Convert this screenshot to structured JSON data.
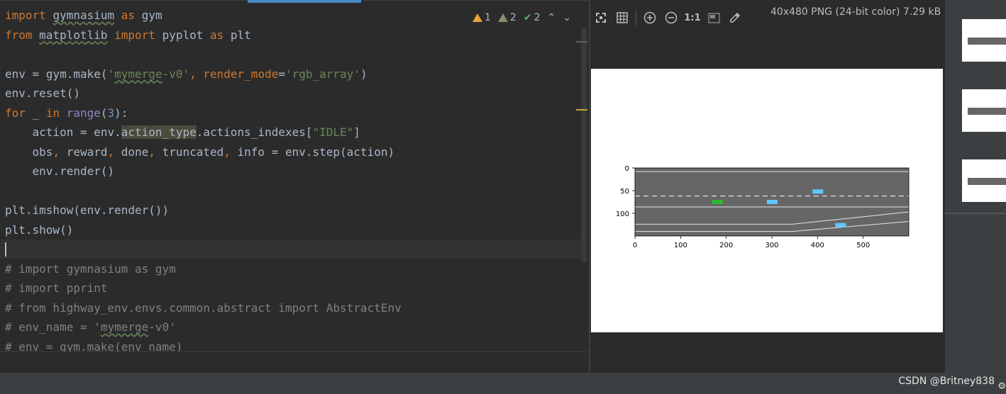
{
  "editor": {
    "lines": [
      [
        {
          "t": "import",
          "c": "kw"
        },
        {
          "t": " "
        },
        {
          "t": "gymnasium",
          "c": "wavy"
        },
        {
          "t": " "
        },
        {
          "t": "as",
          "c": "kw"
        },
        {
          "t": " gym"
        }
      ],
      [
        {
          "t": "from",
          "c": "kw"
        },
        {
          "t": " "
        },
        {
          "t": "matplotlib",
          "c": "wavy"
        },
        {
          "t": " "
        },
        {
          "t": "import",
          "c": "kw"
        },
        {
          "t": " pyplot "
        },
        {
          "t": "as",
          "c": "kw"
        },
        {
          "t": " plt"
        }
      ],
      [
        {
          "t": ""
        }
      ],
      [
        {
          "t": "env = gym.make("
        },
        {
          "t": "'",
          "c": "str"
        },
        {
          "t": "mymerge",
          "c": "str wavy"
        },
        {
          "t": "-v0'",
          "c": "str"
        },
        {
          "t": ", ",
          "c": "kw"
        },
        {
          "t": "render_mode",
          "c": "kw"
        },
        {
          "t": "="
        },
        {
          "t": "'rgb_array'",
          "c": "str"
        },
        {
          "t": ")"
        }
      ],
      [
        {
          "t": "env.reset()"
        }
      ],
      [
        {
          "t": "for",
          "c": "kw"
        },
        {
          "t": " _ "
        },
        {
          "t": "in",
          "c": "kw"
        },
        {
          "t": " "
        },
        {
          "t": "range",
          "c": "builtin"
        },
        {
          "t": "("
        },
        {
          "t": "3",
          "c": "num"
        },
        {
          "t": "):"
        }
      ],
      [
        {
          "t": "    action = env."
        },
        {
          "t": "action_type",
          "c": "hl"
        },
        {
          "t": ".actions_indexes["
        },
        {
          "t": "\"IDLE\"",
          "c": "str"
        },
        {
          "t": "]"
        }
      ],
      [
        {
          "t": "    obs"
        },
        {
          "t": ", ",
          "c": "kw"
        },
        {
          "t": "reward"
        },
        {
          "t": ", ",
          "c": "kw"
        },
        {
          "t": "done"
        },
        {
          "t": ", ",
          "c": "kw"
        },
        {
          "t": "truncated"
        },
        {
          "t": ", ",
          "c": "kw"
        },
        {
          "t": "info = env.step(action)"
        }
      ],
      [
        {
          "t": "    env.render()"
        }
      ],
      [
        {
          "t": ""
        }
      ],
      [
        {
          "t": "plt.imshow(env.render())"
        }
      ],
      [
        {
          "t": "plt.show()"
        }
      ],
      [
        {
          "t": ""
        }
      ],
      [
        {
          "t": "# import gymnasium as gym",
          "c": "comment"
        }
      ],
      [
        {
          "t": "# import pprint",
          "c": "comment"
        }
      ],
      [
        {
          "t": "# from highway_env.envs.common.abstract import AbstractEnv",
          "c": "comment"
        }
      ],
      [
        {
          "t": "# env_name = '",
          "c": "comment"
        },
        {
          "t": "mymerge",
          "c": "comment wavy"
        },
        {
          "t": "-v0'",
          "c": "comment"
        }
      ],
      [
        {
          "t": "# env = gym.make(env_name)",
          "c": "comment"
        }
      ]
    ]
  },
  "inspections": {
    "warnings": "1",
    "weak_warnings": "2",
    "typos": "2"
  },
  "viewer": {
    "image_info": "40x480 PNG (24-bit color) 7.29 kB",
    "actual_size_label": "1:1"
  },
  "plot": {
    "y_ticks": [
      "0",
      "50",
      "100"
    ],
    "x_ticks": [
      "0",
      "100",
      "200",
      "300",
      "400",
      "500"
    ],
    "road_color": "#666666",
    "ego_color": "#2eb82e",
    "vehicle_color": "#5ec8ff"
  },
  "chart_data": {
    "type": "image",
    "xlim": [
      0,
      600
    ],
    "ylim": [
      150,
      0
    ],
    "x_ticks": [
      0,
      100,
      200,
      300,
      400,
      500
    ],
    "y_ticks": [
      0,
      50,
      100
    ],
    "vehicles": [
      {
        "kind": "ego",
        "x": 180,
        "y": 75
      },
      {
        "kind": "other",
        "x": 300,
        "y": 75
      },
      {
        "kind": "other",
        "x": 400,
        "y": 52
      },
      {
        "kind": "other",
        "x": 450,
        "y": 126
      }
    ]
  },
  "watermark": "CSDN @Britney838"
}
